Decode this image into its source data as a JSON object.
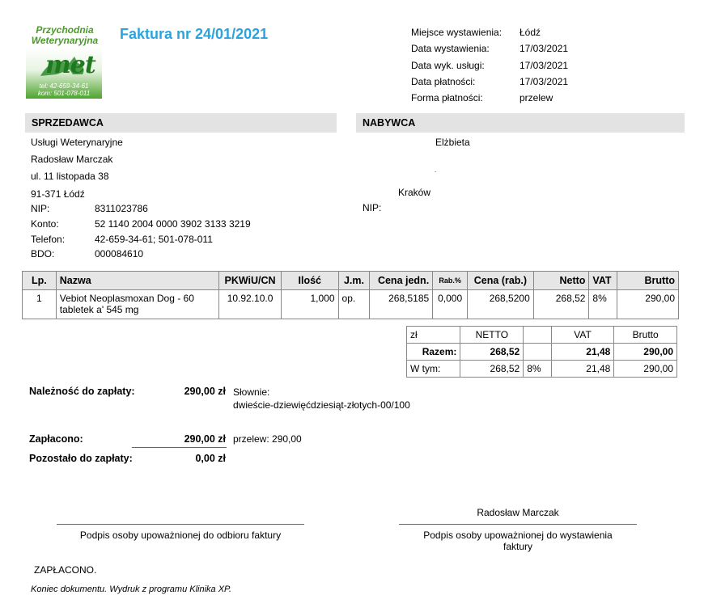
{
  "logo": {
    "line1": "Przychodnia",
    "line2": "Weterynaryjna",
    "mark": "met",
    "tel": "tel: 42-659-34-61",
    "kom": "kom: 501-078-011"
  },
  "title": "Faktura nr 24/01/2021",
  "header_info": [
    {
      "label": "Miejsce wystawienia:",
      "value": "Łódź"
    },
    {
      "label": "Data wystawienia:",
      "value": "17/03/2021"
    },
    {
      "label": "Data wyk. usługi:",
      "value": "17/03/2021"
    },
    {
      "label": "Data płatności:",
      "value": "17/03/2021"
    },
    {
      "label": "Forma płatności:",
      "value": "przelew"
    }
  ],
  "seller": {
    "heading": "SPRZEDAWCA",
    "name": "Usługi Weterynaryjne",
    "owner": "Radosław Marczak",
    "street": "ul. 11 listopada 38",
    "city": "91-371 Łódź",
    "fields": [
      {
        "label": "NIP:",
        "value": "8311023786"
      },
      {
        "label": "Konto:",
        "value": "52 1140 2004 0000 3902 3133 3219"
      },
      {
        "label": "Telefon:",
        "value": "42-659-34-61; 501-078-011"
      },
      {
        "label": "BDO:",
        "value": "000084610"
      }
    ]
  },
  "buyer": {
    "heading": "NABYWCA",
    "name": "Elżbieta",
    "dot": ".",
    "city": "Kraków",
    "nip_label": "NIP:"
  },
  "items_table": {
    "headers": [
      "Lp.",
      "Nazwa",
      "PKWiU/CN",
      "Ilość",
      "J.m.",
      "Cena jedn.",
      "Rab.%",
      "Cena (rab.)",
      "Netto",
      "VAT",
      "Brutto"
    ],
    "rows": [
      [
        "1",
        "Vebiot Neoplasmoxan Dog - 60 tabletek a' 545 mg",
        "10.92.10.0",
        "1,000",
        "op.",
        "268,5185",
        "0,000",
        "268,5200",
        "268,52",
        "8%",
        "290,00"
      ]
    ]
  },
  "summary": {
    "currency": "zł",
    "netto_label": "NETTO",
    "vat_label": "VAT",
    "brutto_label": "Brutto",
    "razem_label": "Razem:",
    "razem_netto": "268,52",
    "razem_vat": "21,48",
    "razem_brutto": "290,00",
    "wtym_label": "W tym:",
    "wtym_netto": "268,52",
    "wtym_rate": "8%",
    "wtym_vat": "21,48",
    "wtym_brutto": "290,00"
  },
  "payment": {
    "due_label": "Należność do zapłaty:",
    "due_amount": "290,00 zł",
    "words_label": "Słownie:",
    "words": "dwieście-dziewięćdziesiąt-złotych-00/100",
    "paid_label": "Zapłacono:",
    "paid_amount": "290,00 zł",
    "paid_method": "przelew: 290,00",
    "remaining_label": "Pozostało do zapłaty:",
    "remaining_amount": "0,00 zł"
  },
  "signatures": {
    "issuer_name": "Radosław Marczak",
    "receiver_caption": "Podpis osoby upoważnionej do odbioru faktury",
    "issuer_caption_1": "Podpis osoby upoważnionej do wystawienia",
    "issuer_caption_2": "faktury"
  },
  "footer": {
    "paid_stamp": "ZAPŁACONO.",
    "end_note": "Koniec dokumentu. Wydruk z programu Klinika XP."
  }
}
